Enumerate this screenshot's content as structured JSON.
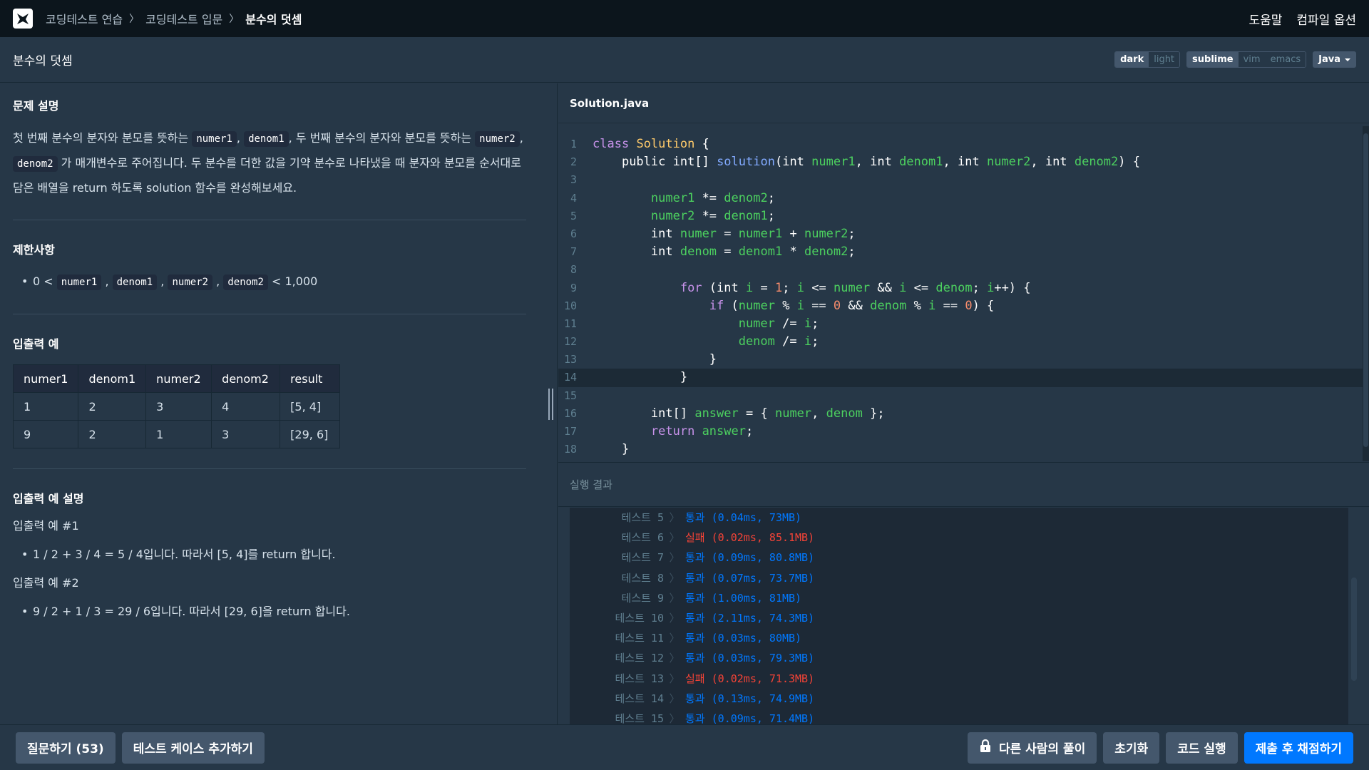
{
  "nav": {
    "breadcrumbs": [
      "코딩테스트 연습",
      "코딩테스트 입문",
      "분수의 덧셈"
    ],
    "help": "도움말",
    "compile_options": "컴파일 옵션"
  },
  "title": "분수의 덧셈",
  "toolbar": {
    "theme": [
      "dark",
      "light"
    ],
    "keymap": [
      "sublime",
      "vim",
      "emacs"
    ],
    "language": "Java"
  },
  "problem": {
    "desc_heading": "문제 설명",
    "desc": {
      "t1": "첫 번째 분수의 분자와 분모를 뜻하는 ",
      "c1": "numer1",
      "t2": ", ",
      "c2": "denom1",
      "t3": ", 두 번째 분수의 분자와 분모를 뜻하는 ",
      "c3": "numer2",
      "t4": ", ",
      "c4": "denom2",
      "t5": " 가 매개변수로 주어집니다. 두 분수를 더한 값을 기약 분수로 나타냈을 때 분자와 분모를 순서대로 담은 배열을 return 하도록 solution 함수를 완성해보세요."
    },
    "constraints_heading": "제한사항",
    "constraint": {
      "pre": "0 < ",
      "c1": "numer1",
      "c2": "denom1",
      "c3": "numer2",
      "c4": "denom2",
      "comma": ",",
      "post": " < 1,000"
    },
    "io_heading": "입출력 예",
    "io_table": {
      "headers": [
        "numer1",
        "denom1",
        "numer2",
        "denom2",
        "result"
      ],
      "rows": [
        [
          "1",
          "2",
          "3",
          "4",
          "[5, 4]"
        ],
        [
          "9",
          "2",
          "1",
          "3",
          "[29, 6]"
        ]
      ]
    },
    "io_explain_heading": "입출력 예 설명",
    "ex1_title": "입출력 예 #1",
    "ex1_text": "1 / 2 + 3 / 4 = 5 / 4입니다. 따라서 [5, 4]를 return 합니다.",
    "ex2_title": "입출력 예 #2",
    "ex2_text": "9 / 2 + 1 / 3 = 29 / 6입니다. 따라서 [29, 6]을 return 합니다."
  },
  "editor": {
    "filename": "Solution.java",
    "line_numbers": [
      "1",
      "2",
      "3",
      "4",
      "5",
      "6",
      "7",
      "8",
      "9",
      "10",
      "11",
      "12",
      "13",
      "14",
      "15",
      "16",
      "17",
      "18"
    ]
  },
  "results": {
    "heading": "실행 결과",
    "rows": [
      {
        "name": "테스트 5",
        "sep": "〉",
        "result": "통과 (0.04ms, 73MB)",
        "status": "pass"
      },
      {
        "name": "테스트 6",
        "sep": "〉",
        "result": "실패 (0.02ms, 85.1MB)",
        "status": "fail"
      },
      {
        "name": "테스트 7",
        "sep": "〉",
        "result": "통과 (0.09ms, 80.8MB)",
        "status": "pass"
      },
      {
        "name": "테스트 8",
        "sep": "〉",
        "result": "통과 (0.07ms, 73.7MB)",
        "status": "pass"
      },
      {
        "name": "테스트 9",
        "sep": "〉",
        "result": "통과 (1.00ms, 81MB)",
        "status": "pass"
      },
      {
        "name": "테스트 10",
        "sep": "〉",
        "result": "통과 (2.11ms, 74.3MB)",
        "status": "pass"
      },
      {
        "name": "테스트 11",
        "sep": "〉",
        "result": "통과 (0.03ms, 80MB)",
        "status": "pass"
      },
      {
        "name": "테스트 12",
        "sep": "〉",
        "result": "통과 (0.03ms, 79.3MB)",
        "status": "pass"
      },
      {
        "name": "테스트 13",
        "sep": "〉",
        "result": "실패 (0.02ms, 71.3MB)",
        "status": "fail"
      },
      {
        "name": "테스트 14",
        "sep": "〉",
        "result": "통과 (0.13ms, 74.9MB)",
        "status": "pass"
      },
      {
        "name": "테스트 15",
        "sep": "〉",
        "result": "통과 (0.09ms, 71.4MB)",
        "status": "pass"
      }
    ]
  },
  "bottom": {
    "ask": "질문하기 (53)",
    "add_testcase": "테스트 케이스 추가하기",
    "others_solution": "다른 사람의 풀이",
    "reset": "초기화",
    "run": "코드 실행",
    "submit": "제출 후 채점하기"
  },
  "colors": {
    "background": "#263747",
    "topnav": "#0c151c",
    "primary": "#0078ff",
    "pass": "#0078ff",
    "fail": "#f44336",
    "button": "#44576c"
  },
  "icons": {
    "logo": "programmers-logo-icon",
    "lock": "lock-icon",
    "caret": "chevron-down-icon"
  }
}
